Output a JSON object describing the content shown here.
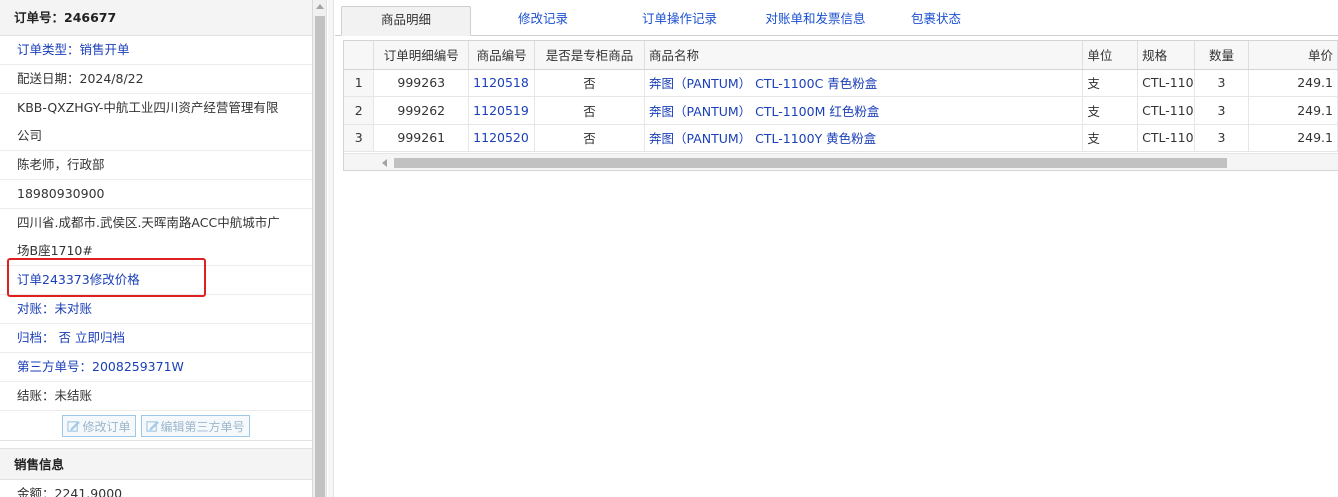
{
  "left": {
    "order_no_label": "订单号：",
    "order_no": "246677",
    "order_type": "订单类型：销售开单",
    "delivery_date": "配送日期：2024/8/22",
    "customer_line1": "KBB-QXZHGY-中航工业四川资产经营管理有限",
    "customer_line2": "公司",
    "contact": "陈老师，行政部",
    "phone": "18980930900",
    "address_line1": "四川省.成都市.武侯区.天晖南路ACC中航城市广",
    "address_line2": "场B座1710#",
    "price_change_link": "订单243373修改价格",
    "reconcile_label": "对账：",
    "reconcile_value": "未对账",
    "archive_label": "归档：",
    "archive_value": "否",
    "archive_action": "立即归档",
    "third_party_label": "第三方单号：",
    "third_party_no": "2008259371W",
    "settle": "结账：未结账",
    "edit_order_btn": "修改订单",
    "edit_third_btn": "编辑第三方单号",
    "sales_info_title": "销售信息",
    "amount": "金额：2241.9000"
  },
  "tabs": [
    {
      "label": "商品明细",
      "active": true
    },
    {
      "label": "修改记录",
      "active": false
    },
    {
      "label": "订单操作记录",
      "active": false
    },
    {
      "label": "对账单和发票信息",
      "active": false
    },
    {
      "label": "包裹状态",
      "active": false
    }
  ],
  "grid": {
    "columns": [
      "",
      "订单明细编号",
      "商品编号",
      "是否是专柜商品",
      "商品名称",
      "单位",
      "规格",
      "数量",
      "单价"
    ],
    "rows": [
      [
        "1",
        "999263",
        "1120518",
        "否",
        "奔图（PANTUM） CTL-1100C 青色粉盒",
        "支",
        "CTL-110",
        "3",
        "249.1"
      ],
      [
        "2",
        "999262",
        "1120519",
        "否",
        "奔图（PANTUM） CTL-1100M 红色粉盒",
        "支",
        "CTL-110",
        "3",
        "249.1"
      ],
      [
        "3",
        "999261",
        "1120520",
        "否",
        "奔图（PANTUM） CTL-1100Y 黄色粉盒",
        "支",
        "CTL-110",
        "3",
        "249.1"
      ]
    ]
  },
  "colors": {
    "link": "#1a3fb8",
    "highlight": "#e02020",
    "tab_text": "#1a4fd0"
  }
}
